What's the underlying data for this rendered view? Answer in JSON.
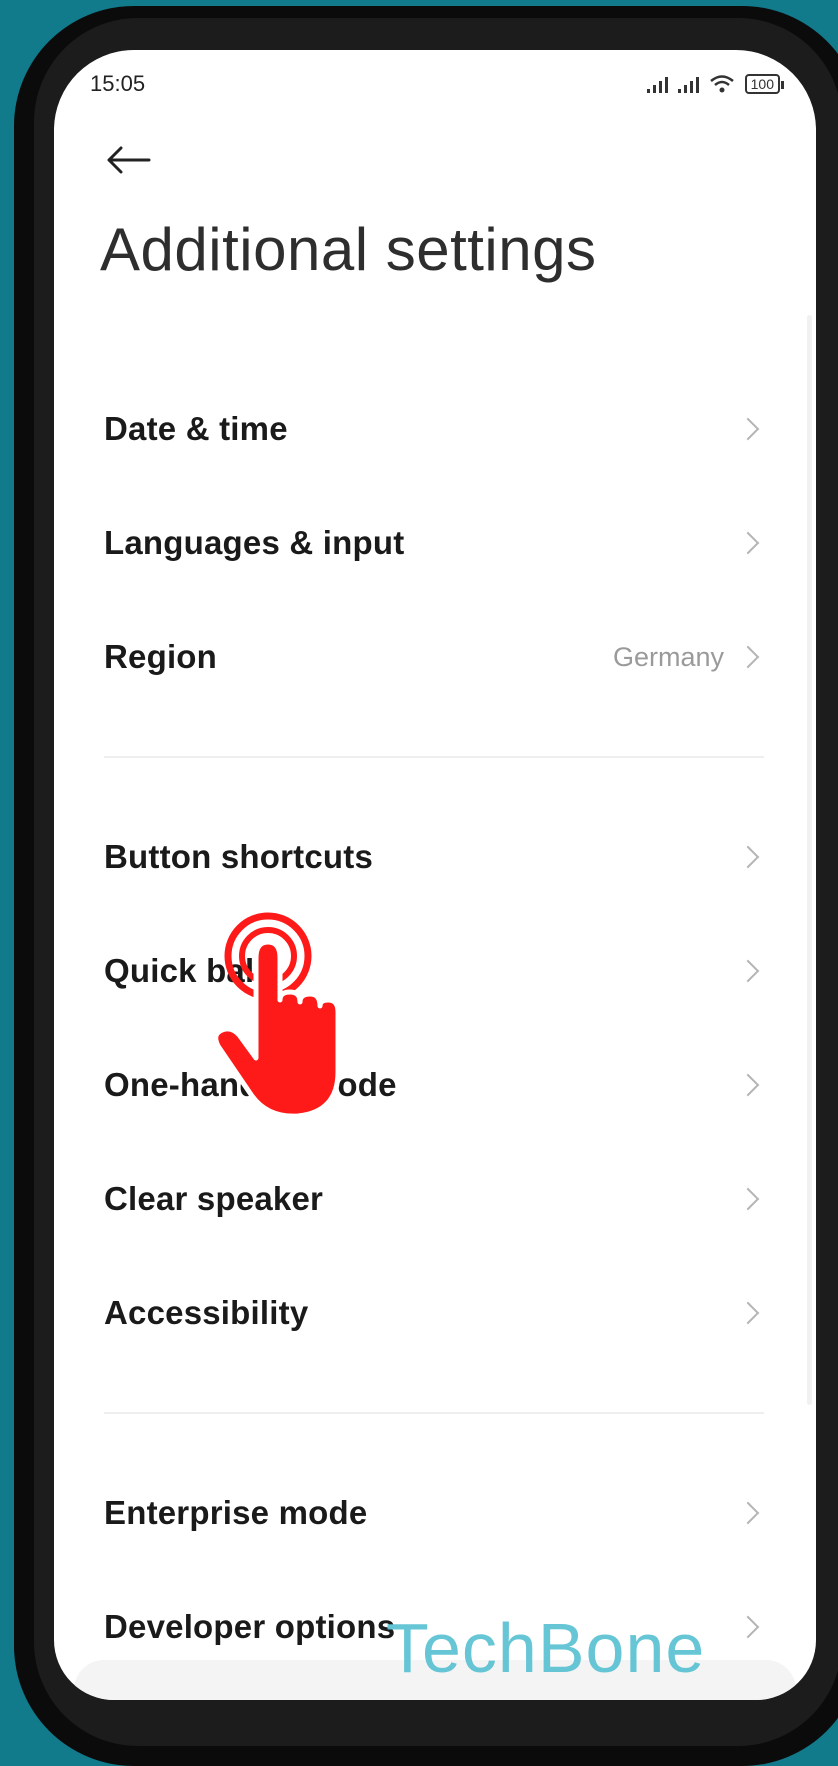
{
  "status_bar": {
    "time": "15:05",
    "battery": "100"
  },
  "header": {
    "back_icon": "back-arrow-icon",
    "title": "Additional settings"
  },
  "groups": [
    {
      "items": [
        {
          "label": "Date & time",
          "value": ""
        },
        {
          "label": "Languages & input",
          "value": ""
        },
        {
          "label": "Region",
          "value": "Germany"
        }
      ]
    },
    {
      "items": [
        {
          "label": "Button shortcuts",
          "value": ""
        },
        {
          "label": "Quick ball",
          "value": ""
        },
        {
          "label": "One-handed mode",
          "value": ""
        },
        {
          "label": "Clear speaker",
          "value": ""
        },
        {
          "label": "Accessibility",
          "value": ""
        }
      ]
    },
    {
      "items": [
        {
          "label": "Enterprise mode",
          "value": ""
        },
        {
          "label": "Developer options",
          "value": ""
        }
      ]
    }
  ],
  "overlay": {
    "pointer_icon": "tap-hand-icon",
    "watermark": "TechBone"
  },
  "colors": {
    "background": "#117a8b",
    "pointer": "#ff1a1a",
    "watermark": "#5ec3d4"
  }
}
